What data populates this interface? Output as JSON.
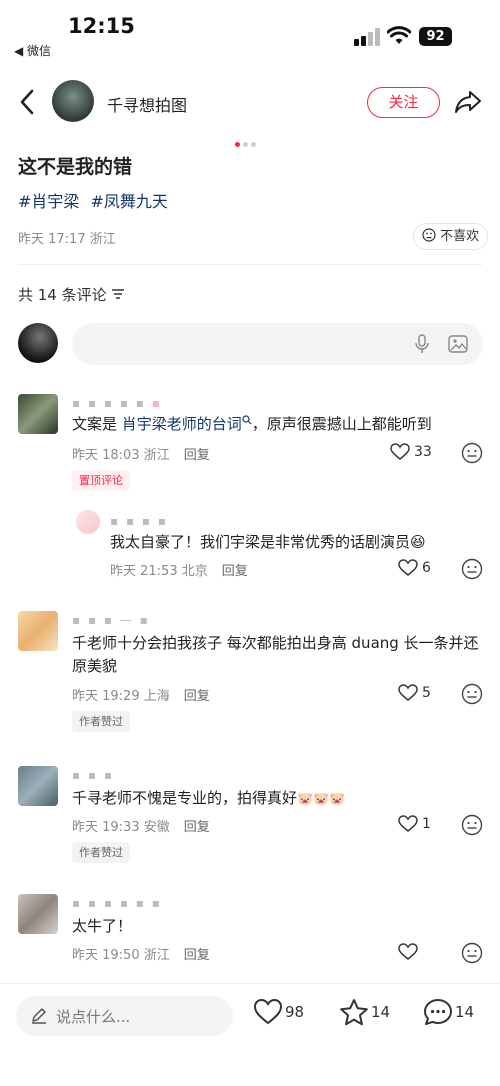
{
  "status_bar": {
    "time": "12:15",
    "back_app": "◀ 微信",
    "battery": "92"
  },
  "header": {
    "author_name": "千寻想拍图",
    "follow_label": "关注"
  },
  "post": {
    "title": "这不是我的错",
    "tags": [
      "#肖宇梁",
      "#凤舞九天"
    ],
    "meta": "昨天 17:17 浙江",
    "dislike_label": "不喜欢"
  },
  "comments_section": {
    "count_label": "共 14 条评论",
    "input_placeholder": ""
  },
  "comments": [
    {
      "text_prefix": "文案是 ",
      "text_link": "肖宇梁老师的台词",
      "text_suffix": "，原声很震撼山上都能听到",
      "meta": "昨天 18:03 浙江",
      "reply": "回复",
      "likes": "33",
      "badge": "置顶评论"
    },
    {
      "text": "我太自豪了！我们宇梁是非常优秀的话剧演员",
      "meta": "昨天 21:53 北京",
      "reply": "回复",
      "likes": "6"
    },
    {
      "text": "千老师十分会拍我孩子 每次都能拍出身高 duang 长一条并还原美貌",
      "meta": "昨天 19:29 上海",
      "reply": "回复",
      "likes": "5",
      "badge": "作者赞过"
    },
    {
      "text": "千寻老师不愧是专业的，拍得真好",
      "meta": "昨天 19:33 安徽",
      "reply": "回复",
      "likes": "1",
      "badge": "作者赞过"
    },
    {
      "text": "太牛了！",
      "meta": "昨天 19:50 浙江",
      "reply": "回复",
      "likes": ""
    }
  ],
  "bottom_bar": {
    "input_placeholder": "说点什么...",
    "likes": "98",
    "collects": "14",
    "comments": "14"
  },
  "colors": {
    "accent": "#ff2442",
    "link": "#13386c",
    "meta": "#8a8a8a"
  },
  "icons": [
    "back-icon",
    "share-icon",
    "wifi-icon",
    "signal-icon",
    "mic-icon",
    "image-icon",
    "heart-icon",
    "star-icon",
    "chat-icon",
    "pen-icon",
    "emoji-icon",
    "filter-icon"
  ]
}
